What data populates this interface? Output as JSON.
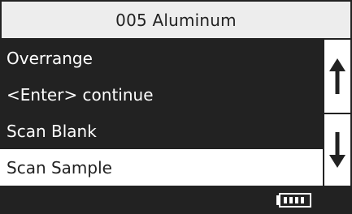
{
  "title": "005 Aluminum",
  "menu": {
    "items": [
      {
        "label": "Overrange"
      },
      {
        "label": "<Enter> continue"
      },
      {
        "label": "Scan Blank"
      },
      {
        "label": "Scan Sample"
      }
    ],
    "selected_index": 3
  },
  "scrollbar": {
    "up_icon": "arrow-up-icon",
    "down_icon": "arrow-down-icon"
  },
  "status": {
    "battery_icon": "battery-icon",
    "battery_level": 1.0
  },
  "colors": {
    "background": "#222222",
    "foreground": "#ffffff",
    "title_bg": "#ededed"
  }
}
